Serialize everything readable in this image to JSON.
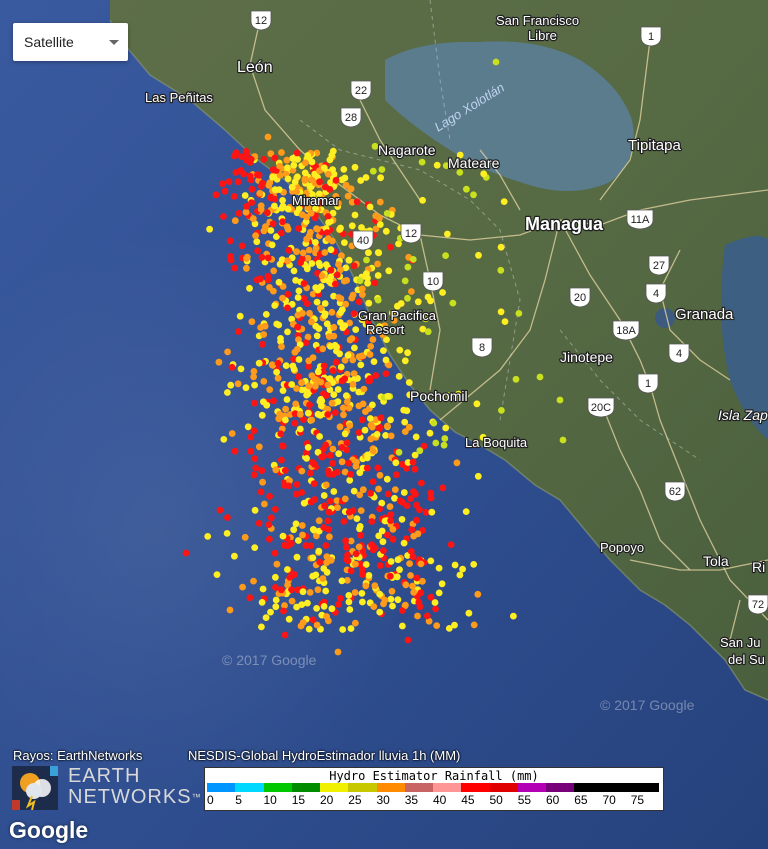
{
  "map_control": {
    "selected": "Satellite"
  },
  "places": [
    {
      "name": "León"
    },
    {
      "name": "Las Peñitas"
    },
    {
      "name": "Nagarote"
    },
    {
      "name": "Mateare"
    },
    {
      "name": "San Francisco"
    },
    {
      "name": "Libre"
    },
    {
      "name": "Tipitapa"
    },
    {
      "name": "Managua"
    },
    {
      "name": "Miramar"
    },
    {
      "name": "Gran Pacifica"
    },
    {
      "name": "Resort"
    },
    {
      "name": "Pochomil"
    },
    {
      "name": "La Boquita"
    },
    {
      "name": "Jinotepe"
    },
    {
      "name": "Granada"
    },
    {
      "name": "Isla Zap"
    },
    {
      "name": "Popoyo"
    },
    {
      "name": "Tola"
    },
    {
      "name": "Ri"
    },
    {
      "name": "San Ju"
    },
    {
      "name": "del Su"
    }
  ],
  "lake_label": "Lago Xolotlán",
  "shields": [
    "12",
    "1",
    "22",
    "28",
    "12",
    "40",
    "10",
    "8",
    "11A",
    "27",
    "4",
    "20",
    "18A",
    "4",
    "1",
    "20C",
    "62",
    "72"
  ],
  "watermarks": [
    "© 2017 Google",
    "© 2017 Google"
  ],
  "credits": {
    "rayos": "Rayos: EarthNetworks",
    "nesdis": "NESDIS-Global HydroEstimador lluvia 1h (MM)",
    "logo_line1": "EARTH",
    "logo_line2": "NETWORKS",
    "logo_tm": "™"
  },
  "legend": {
    "title": "Hydro Estimator Rainfall (mm)",
    "ticks": [
      "0",
      "5",
      "10",
      "15",
      "20",
      "25",
      "30",
      "35",
      "40",
      "45",
      "50",
      "55",
      "60",
      "65",
      "70",
      "75"
    ],
    "colors": [
      "#0096ff",
      "#00d8ff",
      "#00c800",
      "#008c00",
      "#f0f000",
      "#c8c800",
      "#ff8c00",
      "#c86464",
      "#ff9696",
      "#ff0000",
      "#e00000",
      "#b400b4",
      "#780078",
      "#000000",
      "#000000",
      "#000000"
    ]
  },
  "lightning_colors": {
    "high": "#ff1414",
    "mid": "#ff9a1a",
    "low": "#ffee22",
    "lime": "#c8e01e"
  },
  "google": "Google"
}
